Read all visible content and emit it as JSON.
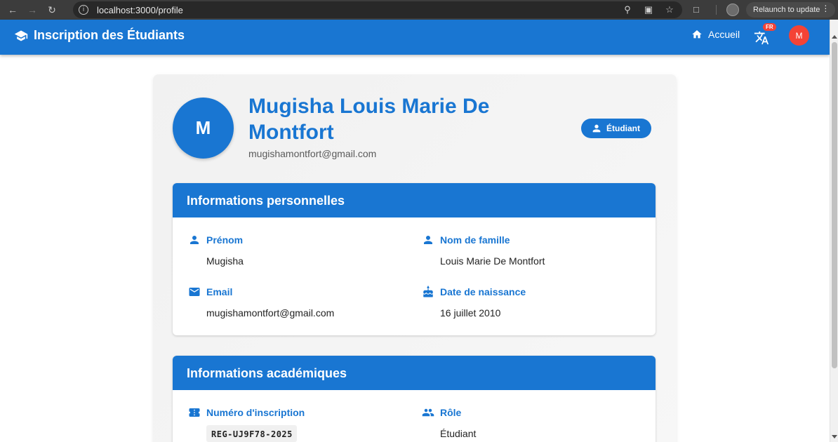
{
  "browser": {
    "url": "localhost:3000/profile",
    "relaunch_label": "Relaunch to update"
  },
  "header": {
    "title": "Inscription des Étudiants",
    "home_label": "Accueil",
    "lang_badge": "FR",
    "avatar_initial": "M"
  },
  "profile": {
    "initial": "M",
    "name": "Mugisha Louis Marie De Montfort",
    "email": "mugishamontfort@gmail.com",
    "role_chip": "Étudiant"
  },
  "personal": {
    "title": "Informations personnelles",
    "first_name_label": "Prénom",
    "first_name": "Mugisha",
    "last_name_label": "Nom de famille",
    "last_name": "Louis Marie De Montfort",
    "email_label": "Email",
    "email": "mugishamontfort@gmail.com",
    "dob_label": "Date de naissance",
    "dob": "16 juillet 2010"
  },
  "academic": {
    "title": "Informations académiques",
    "reg_label": "Numéro d'inscription",
    "reg_number": "REG-UJ9F78-2025",
    "role_label": "Rôle",
    "role": "Étudiant"
  },
  "colors": {
    "primary": "#1976d2",
    "avatar_red": "#f44336"
  }
}
